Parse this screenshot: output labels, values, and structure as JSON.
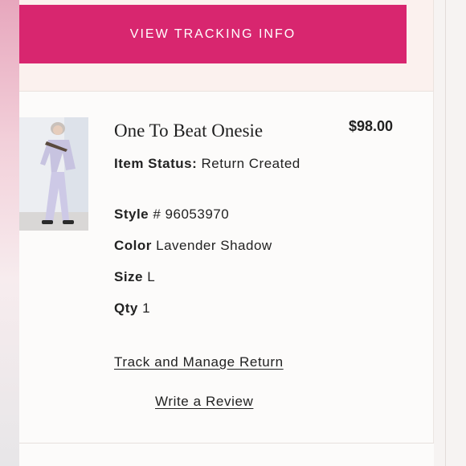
{
  "tracking_button": {
    "label": "VIEW TRACKING INFO"
  },
  "item": {
    "name": "One To Beat Onesie",
    "price": "$98.00",
    "status_label": "Item Status:",
    "status_value": "Return Created",
    "style_label": "Style",
    "style_value": "# 96053970",
    "color_label": "Color",
    "color_value": "Lavender Shadow",
    "size_label": "Size",
    "size_value": "L",
    "qty_label": "Qty",
    "qty_value": "1"
  },
  "links": {
    "track_return": "Track and Manage Return",
    "review": "Write a Review"
  },
  "colors": {
    "accent": "#d8266f",
    "panel": "#fbf1ee",
    "card": "#fcfbfa"
  }
}
